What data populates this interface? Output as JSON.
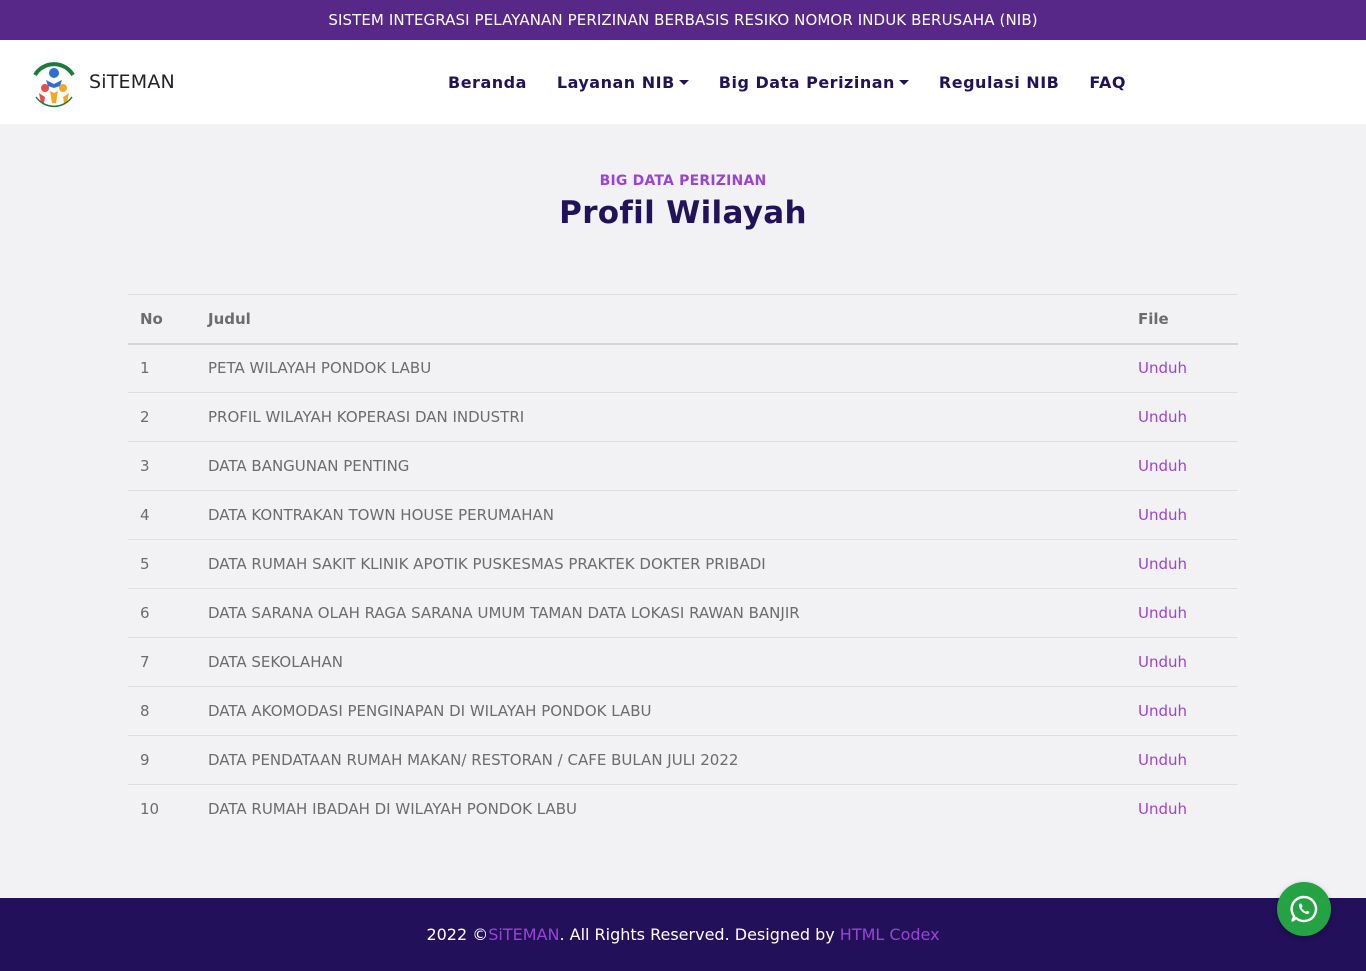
{
  "topbar": {
    "text": "SISTEM INTEGRASI PELAYANAN PERIZINAN BERBASIS RESIKO NOMOR INDUK BERUSAHA (NIB)"
  },
  "brand": {
    "name": "SiTEMAN"
  },
  "nav": {
    "items": [
      {
        "label": "Beranda",
        "dropdown": false
      },
      {
        "label": "Layanan NIB",
        "dropdown": true
      },
      {
        "label": "Big Data Perizinan",
        "dropdown": true
      },
      {
        "label": "Regulasi NIB",
        "dropdown": false
      },
      {
        "label": "FAQ",
        "dropdown": false
      }
    ]
  },
  "section": {
    "subtitle": "BIG DATA PERIZINAN",
    "title": "Profil Wilayah"
  },
  "table": {
    "headers": {
      "no": "No",
      "judul": "Judul",
      "file": "File"
    },
    "rows": [
      {
        "no": "1",
        "judul": "PETA WILAYAH PONDOK LABU",
        "file": "Unduh"
      },
      {
        "no": "2",
        "judul": "PROFIL WILAYAH KOPERASI DAN INDUSTRI",
        "file": "Unduh"
      },
      {
        "no": "3",
        "judul": "DATA BANGUNAN PENTING",
        "file": "Unduh"
      },
      {
        "no": "4",
        "judul": "DATA KONTRAKAN TOWN HOUSE PERUMAHAN",
        "file": "Unduh"
      },
      {
        "no": "5",
        "judul": "DATA RUMAH SAKIT KLINIK APOTIK PUSKESMAS PRAKTEK DOKTER PRIBADI",
        "file": "Unduh"
      },
      {
        "no": "6",
        "judul": "DATA SARANA OLAH RAGA SARANA UMUM TAMAN DATA LOKASI RAWAN BANJIR",
        "file": "Unduh"
      },
      {
        "no": "7",
        "judul": "DATA SEKOLAHAN",
        "file": "Unduh"
      },
      {
        "no": "8",
        "judul": "DATA AKOMODASI PENGINAPAN DI WILAYAH PONDOK LABU",
        "file": "Unduh"
      },
      {
        "no": "9",
        "judul": "DATA PENDATAAN RUMAH MAKAN/ RESTORAN / CAFE BULAN JULI 2022",
        "file": "Unduh"
      },
      {
        "no": "10",
        "judul": "DATA RUMAH IBADAH DI WILAYAH PONDOK LABU",
        "file": "Unduh"
      }
    ]
  },
  "footer": {
    "prefix": "2022 © ",
    "brand_link": "SiTEMAN",
    "middle": ". All Rights Reserved. Designed by ",
    "designer_link": "HTML Codex"
  },
  "icons": {
    "whatsapp": "whatsapp-icon",
    "dropdown": "caret-down-icon",
    "logo": "siteman-logo"
  },
  "colors": {
    "topbar_bg": "#572887",
    "primary_dark": "#22125a",
    "accent": "#9a44d4",
    "whatsapp": "#25a244",
    "footer_bg": "#22105a"
  }
}
